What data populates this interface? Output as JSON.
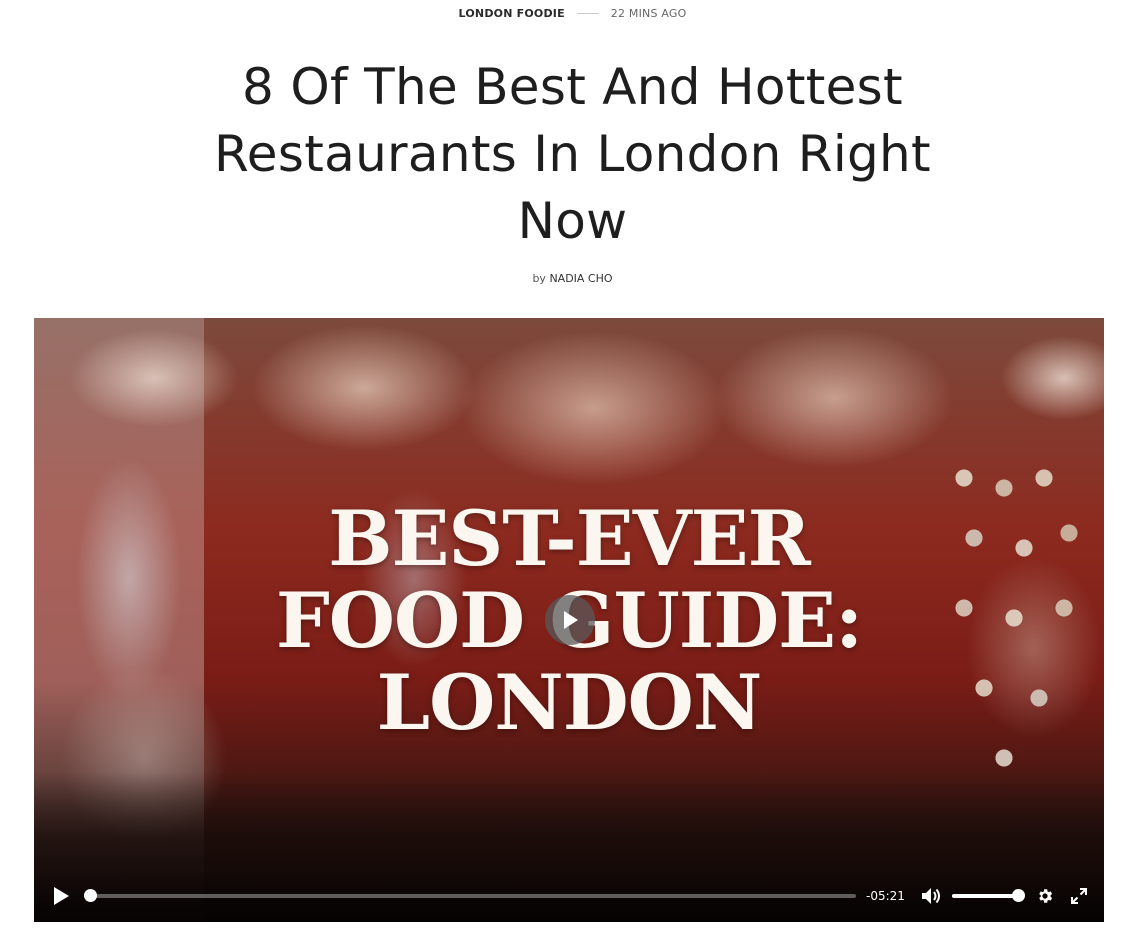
{
  "article": {
    "category": "LONDON FOODIE",
    "time_ago": "22 MINS AGO",
    "title": "8 Of The Best And Hottest Restaurants In London Right Now",
    "byline_prefix": "by",
    "author": "NADIA CHO"
  },
  "video": {
    "overlay_title": "BEST-EVER\nFOOD GUIDE:\nLONDON",
    "time_remaining": "-05:21",
    "progress_fraction": 0.0,
    "volume_fraction": 1.0,
    "icons": {
      "center_play": "play-icon",
      "play": "play-icon",
      "volume": "volume-icon",
      "settings": "gear-icon",
      "fullscreen": "fullscreen-icon"
    }
  },
  "colors": {
    "text_dark": "#1e1e1e",
    "player_controls": "#ffffff",
    "wall_red": "#8d2a1f"
  }
}
